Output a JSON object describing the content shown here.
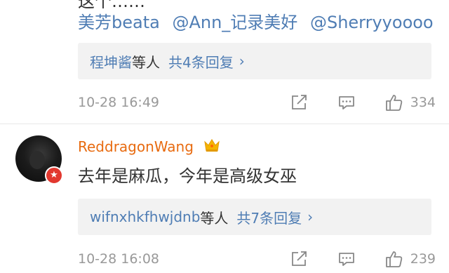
{
  "comment1": {
    "partial_text": "这个……",
    "mentions": [
      "美芳beata",
      "@Ann_记录美好",
      "@Sherryyoooo"
    ],
    "replies": {
      "user": "程坤酱",
      "etc": "等人",
      "count": "共4条回复",
      "chevron": "›"
    },
    "time": "10-28 16:49",
    "likes": "334"
  },
  "comment2": {
    "username": "ReddragonWang",
    "badge_icon": "verified-badge",
    "crown_icon": "vip-crown",
    "text": "去年是麻瓜，今年是高级女巫",
    "replies": {
      "user": "wifnxhkfhwjdnb",
      "etc": "等人",
      "count": "共7条回复",
      "chevron": "›"
    },
    "time": "10-28 16:08",
    "likes": "239"
  },
  "colors": {
    "link": "#4f7db4",
    "username": "#e86b10",
    "meta": "#999999",
    "reply_bg": "#f2f2f2"
  }
}
